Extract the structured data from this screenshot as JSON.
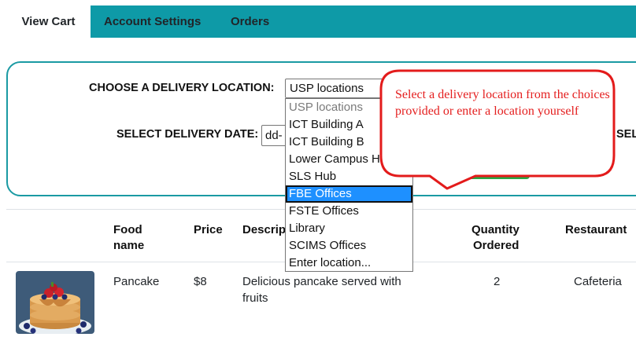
{
  "tabs": [
    {
      "label": "View Cart",
      "active": true
    },
    {
      "label": "Account Settings",
      "active": false
    },
    {
      "label": "Orders",
      "active": false
    }
  ],
  "delivery": {
    "location_label": "CHOOSE A DELIVERY LOCATION:",
    "location_value": "USP locations",
    "date_label": "SELECT DELIVERY DATE:",
    "date_value": "dd-",
    "truncated_label": "SEL"
  },
  "location_options": [
    "USP locations",
    "ICT Building A",
    "ICT Building B",
    "Lower Campus H",
    "SLS Hub",
    "FBE Offices",
    "FSTE Offices",
    "Library",
    "SCIMS Offices",
    "Enter location..."
  ],
  "selected_option": "FBE Offices",
  "callout": {
    "text": "Select a delivery location from the choices provided or enter a location yourself"
  },
  "table": {
    "headers": {
      "food_name_1": "Food",
      "food_name_2": "name",
      "price": "Price",
      "description": "Descrip",
      "quantity_1": "Quantity",
      "quantity_2": "Ordered",
      "restaurant": "Restaurant"
    },
    "rows": [
      {
        "food_name": "Pancake",
        "price": "$8",
        "description_1": "Delicious pancake served with",
        "description_2": "fruits",
        "quantity": "2",
        "restaurant": "Cafeteria"
      }
    ]
  },
  "colors": {
    "tab_bar": "#0e9aa7",
    "box_border": "#1a9aa3",
    "callout_border": "#e31b1b",
    "callout_text": "#e41e1e",
    "selected_option": "#1e90ff"
  }
}
